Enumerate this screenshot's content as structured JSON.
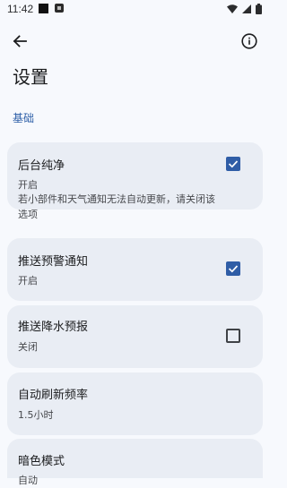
{
  "status_bar": {
    "time": "11:42"
  },
  "top_bar": {
    "back_icon": "arrow-left-icon",
    "info_icon": "info-icon"
  },
  "page": {
    "title": "设置"
  },
  "section": {
    "header": "基础"
  },
  "settings": [
    {
      "title": "后台纯净",
      "subtitle": "开启",
      "description": "若小部件和天气通知无法自动更新，请关闭该选项",
      "checked": true
    },
    {
      "title": "推送预警通知",
      "subtitle": "开启",
      "checked": true
    },
    {
      "title": "推送降水预报",
      "subtitle": "关闭",
      "checked": false
    },
    {
      "title": "自动刷新频率",
      "subtitle": "1.5小时"
    },
    {
      "title": "暗色模式",
      "subtitle": "自动"
    }
  ],
  "colors": {
    "accent": "#2f5da6",
    "card": "#e9edf4",
    "background": "#f7f9fd"
  }
}
